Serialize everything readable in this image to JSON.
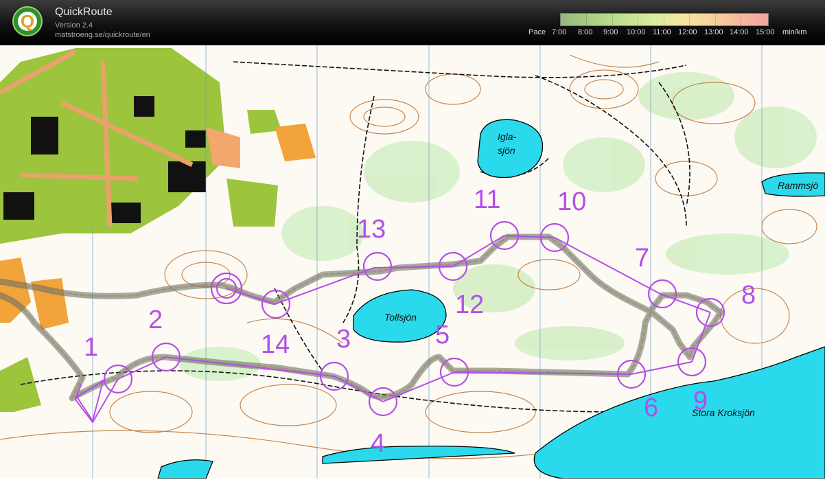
{
  "app": {
    "title": "QuickRoute",
    "version": "Version 2.4",
    "url": "matstroeng.se/quickroute/en"
  },
  "pace_legend": {
    "label": "Pace",
    "ticks": [
      "7:00",
      "8:00",
      "9:00",
      "10:00",
      "11:00",
      "12:00",
      "13:00",
      "14:00",
      "15:00"
    ],
    "unit": "min/km"
  },
  "map": {
    "lake_labels": {
      "iglasjon_line1": "Igla-",
      "iglasjon_line2": "sjön",
      "tollsjon": "Tollsjön",
      "rammsjon": "Rammsjö",
      "stora_kroksjon": "Stora Kroksjön"
    },
    "controls": [
      "1",
      "2",
      "3",
      "4",
      "5",
      "6",
      "7",
      "8",
      "9",
      "10",
      "11",
      "12",
      "13",
      "14"
    ]
  },
  "colors": {
    "course": "#b44ee8",
    "water": "#2ad9ec",
    "open_land": "#f2a33a",
    "vegetation": "#9cc43c",
    "contour": "#b86a28",
    "route": "#6a7a68"
  }
}
